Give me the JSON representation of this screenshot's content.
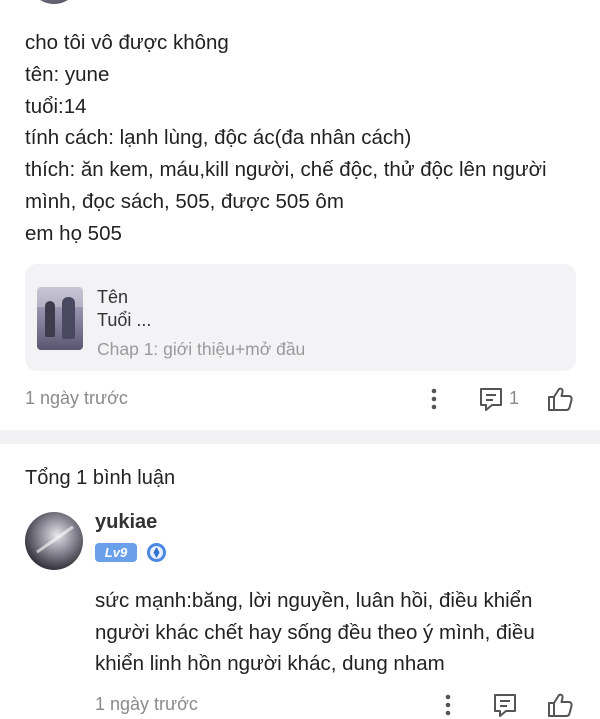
{
  "post": {
    "lines": [
      "cho tôi vô được không",
      "tên: yune",
      "tuổi:14",
      "tính cách: lạnh lùng, độc ác(đa nhân cách)",
      "thích: ăn kem, máu,kill người, chế độc, thử độc lên người",
      "mình, đọc sách, 505, được 505 ôm",
      "em họ 505"
    ]
  },
  "chapter_card": {
    "line1": "Tên",
    "line2": "Tuổi ...",
    "chapter": "Chap 1: giới thiệu+mở đầu"
  },
  "post_meta": {
    "time": "1 ngày trước",
    "reply_count": "1",
    "icons": [
      "more-vertical-icon",
      "comment-icon",
      "thumbs-up-icon"
    ]
  },
  "comments_header": {
    "title": "Tổng 1 bình luận"
  },
  "comment": {
    "username": "yukiae",
    "level": "Lv9",
    "lines": [
      "sức mạnh:băng, lời nguyền, luân hồi, điều khiển",
      "người khác chết hay sống đều theo ý mình, điều",
      "khiển linh hồn người khác, dung nham"
    ],
    "time": "1 ngày trước",
    "icons": [
      "more-vertical-icon",
      "comment-icon",
      "thumbs-up-icon"
    ]
  },
  "colors": {
    "text": "#222222",
    "muted": "#8a8a8a",
    "card_bg": "#f3f3f5",
    "divider": "#f2f2f4",
    "level_badge": "#6aa0ea"
  }
}
